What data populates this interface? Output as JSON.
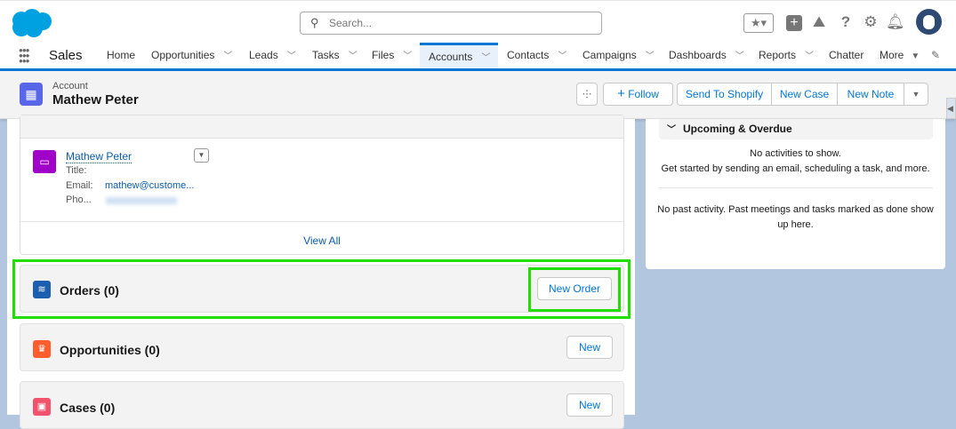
{
  "header": {
    "search_placeholder": "Search...",
    "icons": [
      "favorites-star-icon",
      "global-actions-plus-icon",
      "trailhead-icon",
      "help-icon",
      "setup-gear-icon",
      "notifications-bell-icon",
      "user-avatar"
    ]
  },
  "nav": {
    "app_name": "Sales",
    "items": [
      {
        "label": "Home",
        "dropdown": false
      },
      {
        "label": "Opportunities",
        "dropdown": true
      },
      {
        "label": "Leads",
        "dropdown": true
      },
      {
        "label": "Tasks",
        "dropdown": true
      },
      {
        "label": "Files",
        "dropdown": true
      },
      {
        "label": "Accounts",
        "dropdown": true,
        "active": true
      },
      {
        "label": "Contacts",
        "dropdown": true
      },
      {
        "label": "Campaigns",
        "dropdown": true
      },
      {
        "label": "Dashboards",
        "dropdown": true
      },
      {
        "label": "Reports",
        "dropdown": true
      },
      {
        "label": "Chatter",
        "dropdown": false
      }
    ],
    "more_label": "More"
  },
  "record": {
    "object_label": "Account",
    "name": "Mathew Peter",
    "follow_label": "Follow",
    "actions": [
      "Send To Shopify",
      "New Case",
      "New Note"
    ]
  },
  "contact": {
    "name": "Mathew Peter",
    "title_label": "Title:",
    "email_label": "Email:",
    "email": "mathew@custome...",
    "phone_label": "Pho...",
    "view_all": "View All"
  },
  "related": [
    {
      "title": "Orders (0)",
      "button": "New Order",
      "color": "#1b5fae"
    },
    {
      "title": "Opportunities (0)",
      "button": "New",
      "color": "#ff5d2d"
    },
    {
      "title": "Cases (0)",
      "button": "New",
      "color": "#f2536c"
    }
  ],
  "activity": {
    "section": "Upcoming & Overdue",
    "empty_line1": "No activities to show.",
    "empty_line2": "Get started by sending an email, scheduling a task, and more.",
    "past": "No past activity. Past meetings and tasks marked as done show up here."
  },
  "colors": {
    "brand": "#0176d3",
    "highlight": "#22dd00"
  }
}
